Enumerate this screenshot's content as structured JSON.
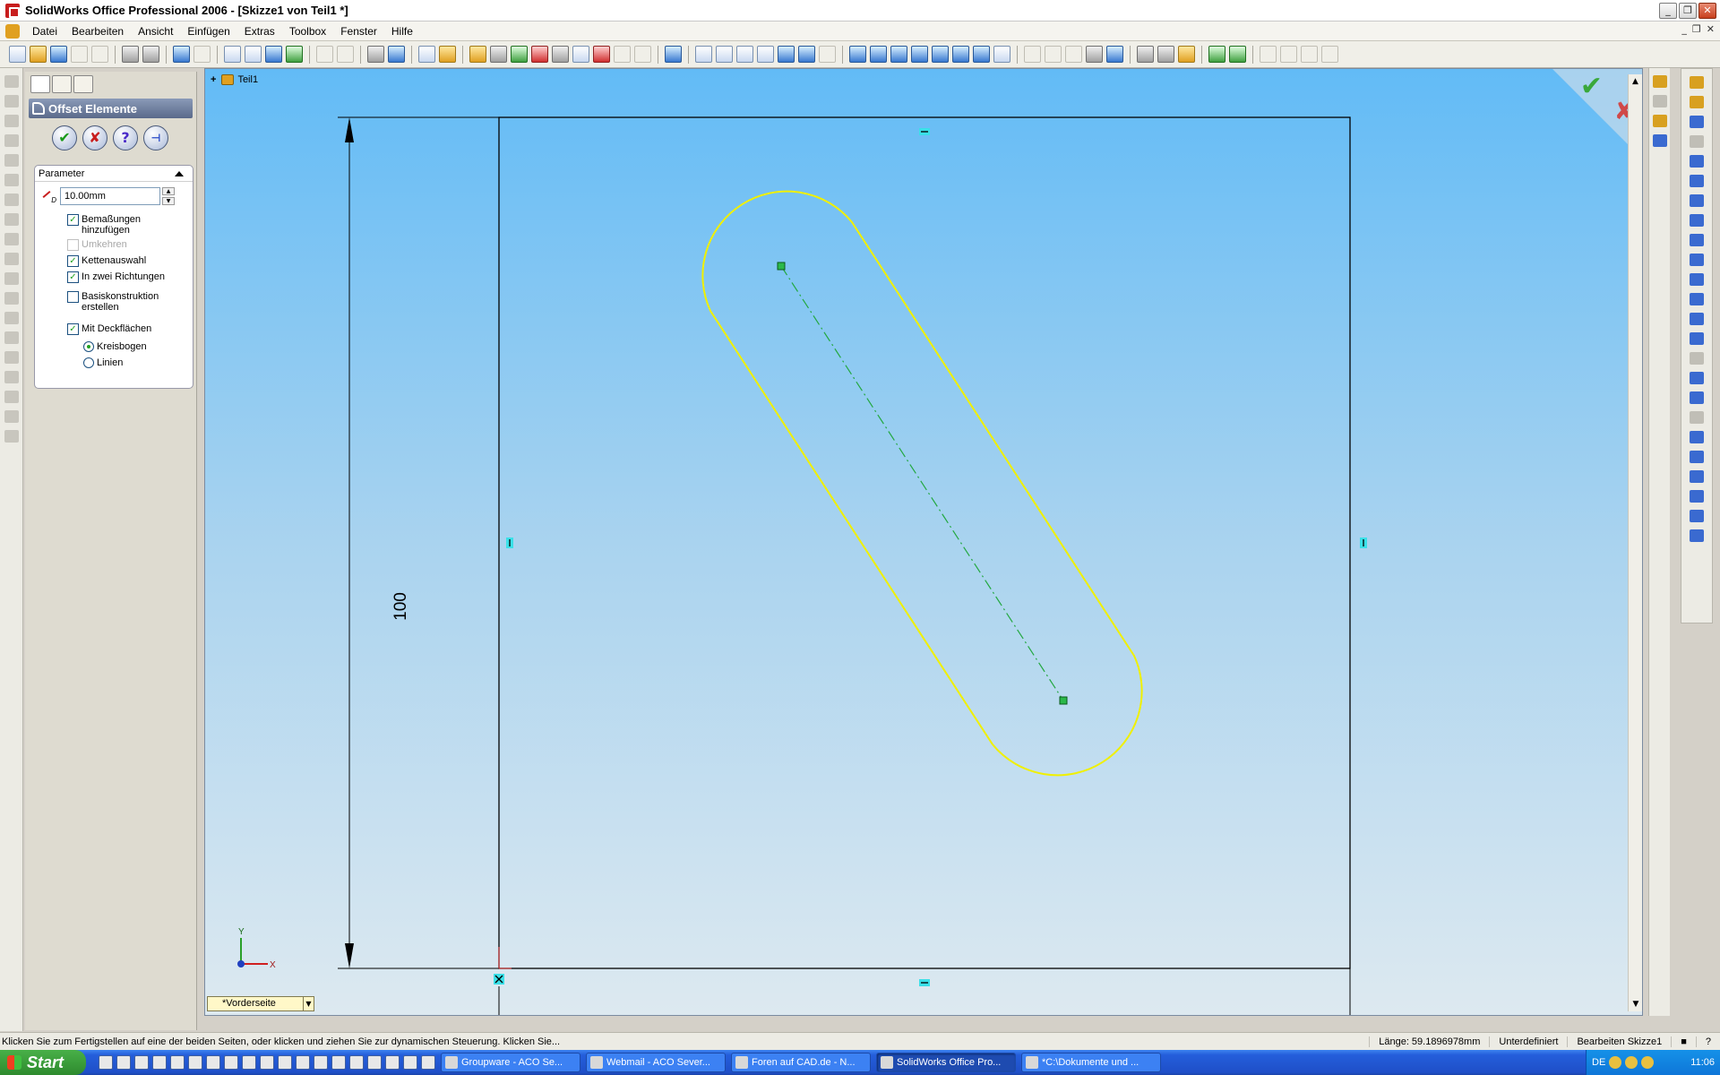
{
  "window": {
    "title": "SolidWorks Office Professional 2006 - [Skizze1 von Teil1 *]",
    "minimize": "_",
    "restore": "❐",
    "close": "✕"
  },
  "menu": {
    "items": [
      "Datei",
      "Bearbeiten",
      "Ansicht",
      "Einfügen",
      "Extras",
      "Toolbox",
      "Fenster",
      "Hilfe"
    ]
  },
  "property_manager": {
    "title": "Offset Elemente",
    "group_title": "Parameter",
    "distance_value": "10.00mm",
    "checkboxes": [
      {
        "label": "Bemaßungen hinzufügen",
        "checked": true,
        "enabled": true
      },
      {
        "label": "Umkehren",
        "checked": false,
        "enabled": false
      },
      {
        "label": "Kettenauswahl",
        "checked": true,
        "enabled": true
      },
      {
        "label": "In zwei Richtungen",
        "checked": true,
        "enabled": true
      },
      {
        "label": "Basiskonstruktion erstellen",
        "checked": false,
        "enabled": true
      },
      {
        "label": "Mit Deckflächen",
        "checked": true,
        "enabled": true
      }
    ],
    "radios": [
      {
        "label": "Kreisbogen",
        "selected": true
      },
      {
        "label": "Linien",
        "selected": false
      }
    ]
  },
  "graphics": {
    "tree_root": "Teil1",
    "dimension_value": "100",
    "view_orientation": "*Vorderseite",
    "axis_x": "X",
    "axis_y": "Y",
    "sketch_color": "#f0f000",
    "confirm_check": "✔",
    "confirm_cancel": "✘"
  },
  "status": {
    "message": "Klicken Sie zum Fertigstellen auf eine der beiden Seiten, oder klicken und ziehen Sie zur dynamischen Steuerung. Klicken Sie...",
    "length": "Länge: 59.1896978mm",
    "state": "Unterdefiniert",
    "mode": "Bearbeiten Skizze1"
  },
  "taskbar": {
    "start": "Start",
    "tasks": [
      {
        "label": "Groupware - ACO Se...",
        "active": false
      },
      {
        "label": "Webmail - ACO Sever...",
        "active": false
      },
      {
        "label": "Foren auf CAD.de - N...",
        "active": false
      },
      {
        "label": "SolidWorks Office Pro...",
        "active": true
      },
      {
        "label": "*C:\\Dokumente und ...",
        "active": false
      }
    ],
    "language": "DE",
    "clock": "11:06"
  }
}
